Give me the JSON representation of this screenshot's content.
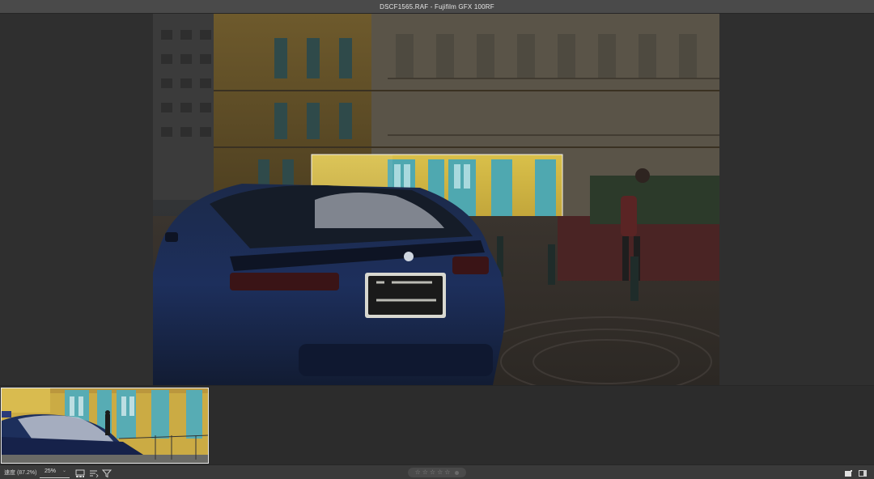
{
  "window": {
    "title": "DSCF1565.RAF - Fujifilm GFX 100RF"
  },
  "viewer": {
    "image_name": "DSCF1565.RAF"
  },
  "toolbar": {
    "progress_label": "速度 (87.2%)",
    "zoom": {
      "value": "25%",
      "caret": "⌄"
    },
    "rating": {
      "stars_total": 5,
      "stars_filled": 0,
      "star_glyph": "☆"
    },
    "icons": {
      "view_mode": "grid-view-icon",
      "sort": "sort-icon",
      "filter": "filter-icon",
      "single_view": "single-view-icon",
      "panel": "panel-toggle-icon"
    }
  },
  "colors": {
    "titlebar": "#4a4a4a",
    "background": "#303030",
    "toolbar": "#3a3a3a",
    "thumb_border": "#e8e8e8"
  }
}
